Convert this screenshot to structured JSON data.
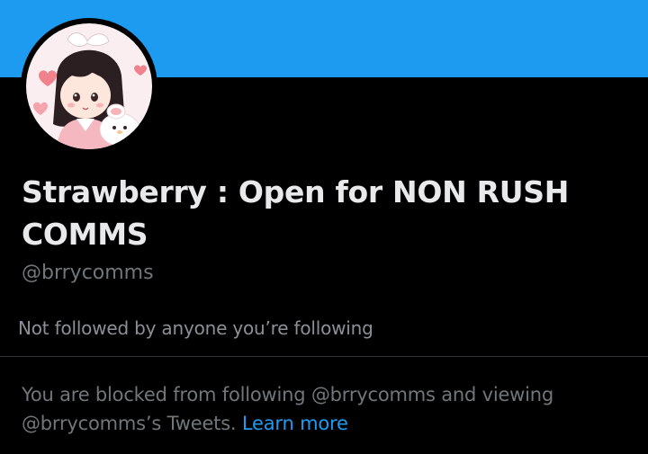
{
  "profile": {
    "display_name": "Strawberry : Open for NON RUSH COMMS",
    "handle": "@brrycomms",
    "followers_note": "Not followed by anyone you’re following"
  },
  "blocked_notice": {
    "line1": "You are blocked from following @brrycomms and viewing",
    "line2": "@brrycomms’s Tweets.",
    "link_label": "Learn more"
  },
  "colors": {
    "banner": "#1d9bf0",
    "background": "#000000",
    "link": "#1d9bf0",
    "primary_text": "#e7e9ea",
    "secondary_text": "#71767b"
  }
}
